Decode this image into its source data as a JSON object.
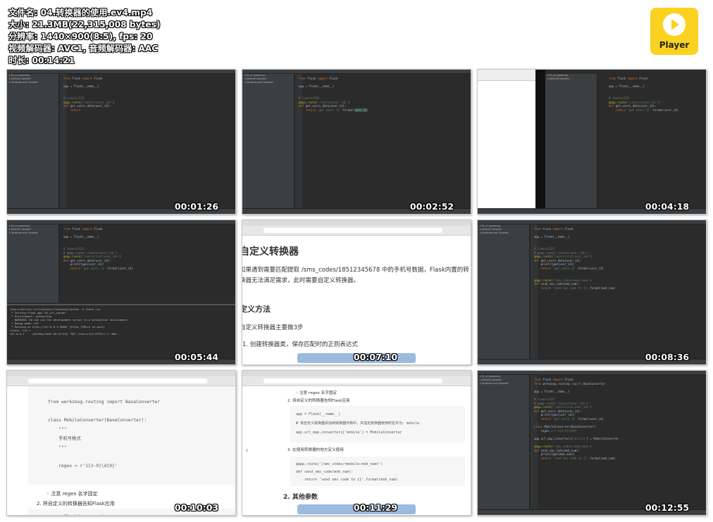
{
  "info": {
    "filename": "文件名: 04.转换器的使用.ev4.mp4",
    "size": "大小: 21.3MB(22,315,008 bytes)",
    "resolution": "分辨率: 1440×900(8:5), fps: 20",
    "codec": "视频解码器: AVC1, 音频解码器: AAC",
    "duration": "时长: 00:14:21"
  },
  "logo": {
    "label": "Player",
    "color": "#fbd21f",
    "icon": "play-icon"
  },
  "thumbnails": [
    {
      "timestamp": "00:01:26"
    },
    {
      "timestamp": "00:02:52"
    },
    {
      "timestamp": "00:04:18"
    },
    {
      "timestamp": "00:05:44"
    },
    {
      "timestamp": "00:07:10"
    },
    {
      "timestamp": "00:08:36"
    },
    {
      "timestamp": "00:10:03"
    },
    {
      "timestamp": "00:11:29"
    },
    {
      "timestamp": "00:12:55"
    }
  ],
  "doc5": {
    "heading": "自定义转换器",
    "para": "如果遇到需要匹配提取 /sms_codes/18512345678 中的手机号数据，Flask内置的转换器无法满足需求，此时需要自定义转换器。",
    "subheading": "定义方法",
    "steps_intro": "自定义转换器主要做3步",
    "step1": "1. 创建转换器类，保存匹配时的正则表达式"
  },
  "doc7": {
    "code": [
      "from werkzeug.routing import BaseConverter",
      "class MobileConverter(BaseConverter):",
      "    \"\"\"",
      "    手机号格式",
      "    \"\"\"",
      "    regex = r'1[3-9]\\d{9}'"
    ],
    "note": "◦ 注意 regex 名字固定",
    "step2": "2. 将自定义的转换器告知Flask应用",
    "code2": "app = Flask(__name__)"
  },
  "doc8": {
    "note": "◦ 注意 regex 名字固定",
    "step2": "2. 将自定义的转换器告知Flask应用",
    "code_a": [
      "app = Flask(__name__)",
      "# 将自定义转换器添加到转换器字典中，并指定转换器使用时名字为: mobile",
      "app.url_map.converters['mobile'] = MobileConverter"
    ],
    "step3": "3. 在使用转换器的地方定义使用",
    "code_b": [
      "@app.route('/sms_codes/<mobile:mob_num>')",
      "def send_sms_code(mob_num):",
      "    return 'send sms code to {}'.format(mob_num)"
    ],
    "h2": "2. 其他参数"
  }
}
